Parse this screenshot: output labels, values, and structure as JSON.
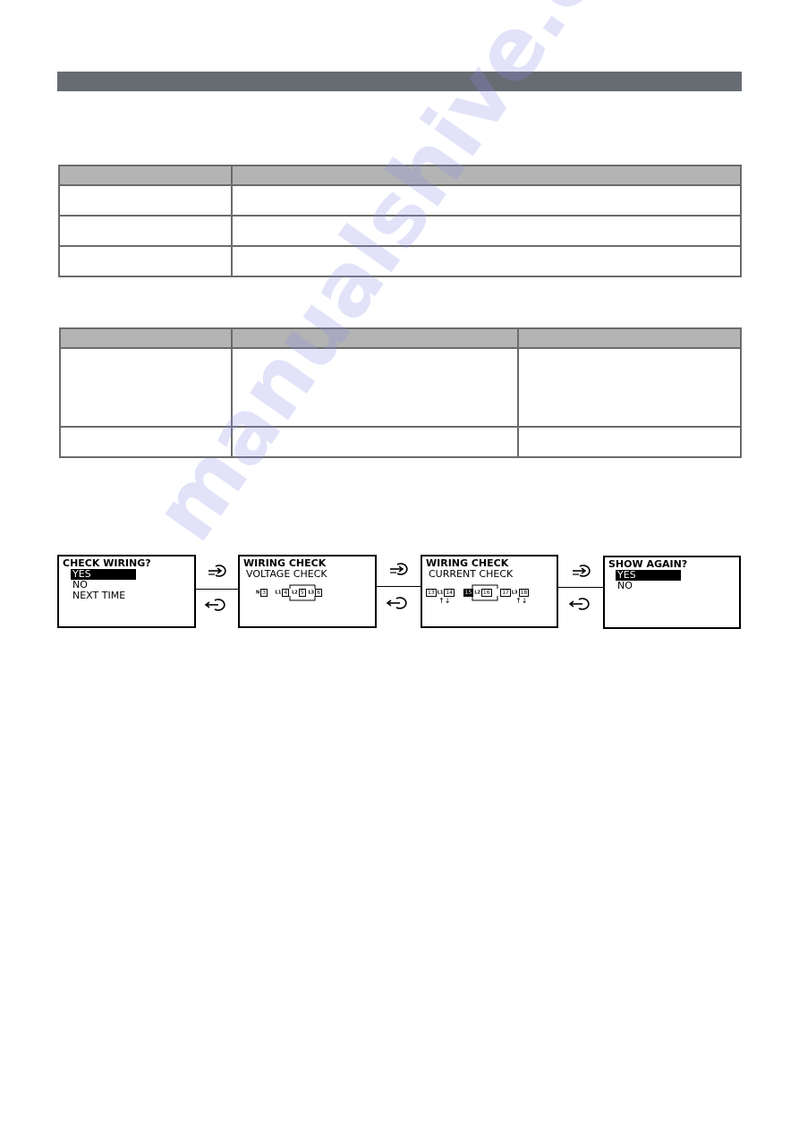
{
  "section_header": {
    "title": ""
  },
  "table1": {
    "headers": [
      "",
      ""
    ],
    "rows": [
      [
        "",
        ""
      ],
      [
        "",
        ""
      ],
      [
        "",
        ""
      ]
    ]
  },
  "table2": {
    "headers": [
      "",
      "",
      ""
    ],
    "rows": [
      [
        "",
        "",
        ""
      ],
      [
        "",
        "",
        ""
      ]
    ]
  },
  "flow": {
    "screens": [
      {
        "title": "CHECK WIRING?",
        "options": [
          "YES",
          "NO",
          "NEXT TIME"
        ],
        "selected": "YES"
      },
      {
        "title": "WIRING CHECK",
        "subtitle": "VOLTAGE CHECK",
        "terminals": [
          {
            "label": "N",
            "num": "3"
          },
          {
            "label": "L1",
            "num": "4"
          },
          {
            "label": "L2",
            "num": "5"
          },
          {
            "label": "L3",
            "num": "6"
          }
        ]
      },
      {
        "title": "WIRING CHECK",
        "subtitle": "CURRENT CHECK",
        "terminals": [
          {
            "label": "L1",
            "left": "13",
            "right": "14"
          },
          {
            "label": "L2",
            "left": "15",
            "right": "16"
          },
          {
            "label": "L3",
            "left": "17",
            "right": "18"
          }
        ]
      },
      {
        "title": "SHOW AGAIN?",
        "options": [
          "YES",
          "NO"
        ],
        "selected": "YES"
      }
    ],
    "icons": {
      "forward": "enter-arrow-icon",
      "back": "return-arrow-icon"
    }
  },
  "watermark": "manualshive.com"
}
